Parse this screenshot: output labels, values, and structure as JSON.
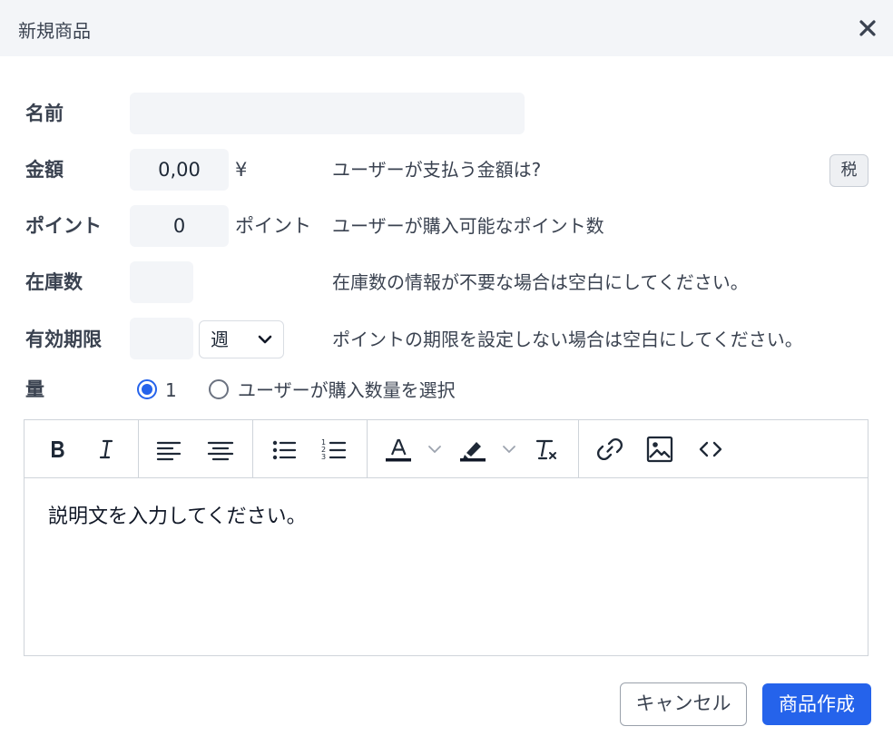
{
  "dialog": {
    "title": "新規商品"
  },
  "form": {
    "name": {
      "label": "名前",
      "value": ""
    },
    "price": {
      "label": "金額",
      "value": "0,00",
      "unit": "¥",
      "hint": "ユーザーが支払う金額は?",
      "tax_label": "税"
    },
    "points": {
      "label": "ポイント",
      "value": "0",
      "unit": "ポイント",
      "hint": "ユーザーが購入可能なポイント数"
    },
    "stock": {
      "label": "在庫数",
      "value": "",
      "hint": "在庫数の情報が不要な場合は空白にしてください。"
    },
    "expiry": {
      "label": "有効期限",
      "value": "",
      "period": "週",
      "hint": "ポイントの期限を設定しない場合は空白にしてください。"
    },
    "quantity": {
      "label": "量",
      "option_fixed": "1",
      "option_select": "ユーザーが購入数量を選択",
      "selected": "1"
    }
  },
  "editor": {
    "toolbar": [
      "bold-icon",
      "italic-icon",
      "align-left-icon",
      "align-center-icon",
      "bullet-list-icon",
      "numbered-list-icon",
      "text-color-icon",
      "highlight-icon",
      "clear-format-icon",
      "link-icon",
      "image-icon",
      "code-icon"
    ],
    "body": "説明文を入力してください。"
  },
  "footer": {
    "cancel_label": "キャンセル",
    "create_label": "商品作成"
  },
  "colors": {
    "accent": "#2563eb",
    "header_bg": "#f3f5f8",
    "field_bg": "#f3f5f8"
  }
}
